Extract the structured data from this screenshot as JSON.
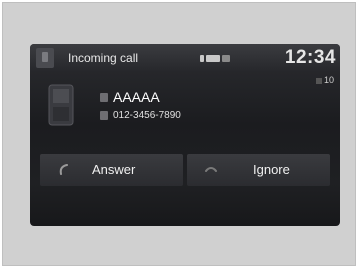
{
  "header": {
    "title": "Incoming call",
    "clock": "12:34"
  },
  "volume": {
    "level": "10"
  },
  "caller": {
    "name": "AAAAA",
    "number": "012-3456-7890"
  },
  "actions": {
    "answer_label": "Answer",
    "ignore_label": "Ignore"
  },
  "colors": {
    "screen_bg": "#1b1c1f",
    "header_bg": "#3b3c40",
    "button_bg": "#35363a",
    "text": "#ffffff"
  },
  "icons": {
    "header": "phone-app-icon",
    "signal": "signal-strength-icon",
    "volume": "volume-icon",
    "caller": "mobile-phone-icon",
    "name": "contact-icon",
    "number": "phone-number-icon",
    "answer": "answer-call-icon",
    "ignore": "ignore-call-icon"
  }
}
